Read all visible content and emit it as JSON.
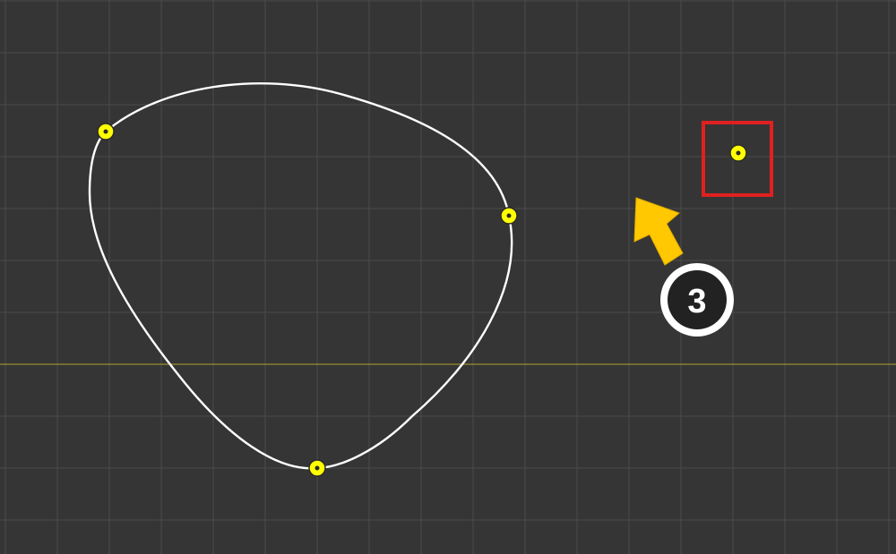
{
  "viewport": {
    "background_color": "#353535",
    "grid_color": "#4a4a4a",
    "axis_color": "#b5a22a"
  },
  "curve": {
    "stroke_color": "#ffffff",
    "control_point_fill": "#ffff00",
    "control_point_stroke": "#2a2a2a",
    "control_point_count": 4
  },
  "highlight": {
    "box_color": "#e02020",
    "point_fill": "#ffff00"
  },
  "annotation": {
    "arrow_color": "#ffc800",
    "step_badge": {
      "number": "3",
      "fill": "#222222",
      "ring": "#ffffff"
    }
  }
}
